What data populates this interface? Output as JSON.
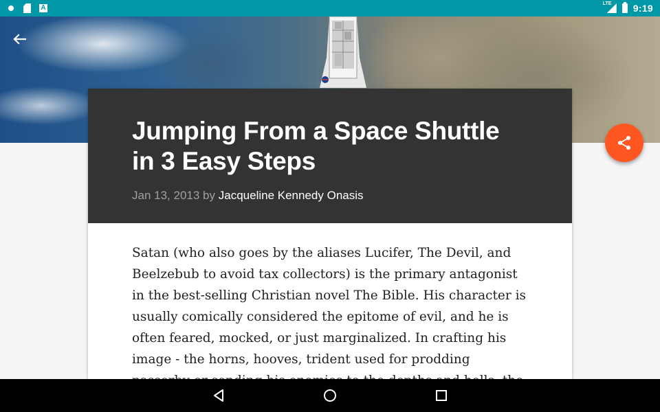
{
  "status_bar": {
    "time": "9:19",
    "network": "LTE",
    "icons": [
      "gear-icon",
      "sd-card-icon",
      "a-icon",
      "lte-signal-icon",
      "battery-icon"
    ]
  },
  "toolbar": {
    "back_icon": "arrow-back-icon"
  },
  "fab": {
    "icon": "share-icon",
    "color": "#ff5722"
  },
  "article": {
    "title": "Jumping From a Space Shuttle in 3 Easy Steps",
    "date": "Jan 13, 2013",
    "by": "by",
    "author": "Jacqueline Kennedy Onasis",
    "body": "Satan (who also goes by the aliases Lucifer, The Devil, and Beelzebub to avoid tax collectors) is the primary antagonist in the best-selling Christian novel The Bible. His character is usually comically considered the epitome of evil, and he is often feared, mocked, or just marginalized. In crafting his image - the horns, hooves, trident used for prodding passerby or sending his enemies to the depths and hells, the Catholic Church tool inspiration from"
  },
  "colors": {
    "status_bar": "#0097a7",
    "header_bg": "#333333",
    "accent": "#ff5722"
  },
  "nav_bar": {
    "icons": [
      "back-triangle-icon",
      "home-circle-icon",
      "recents-square-icon"
    ]
  }
}
